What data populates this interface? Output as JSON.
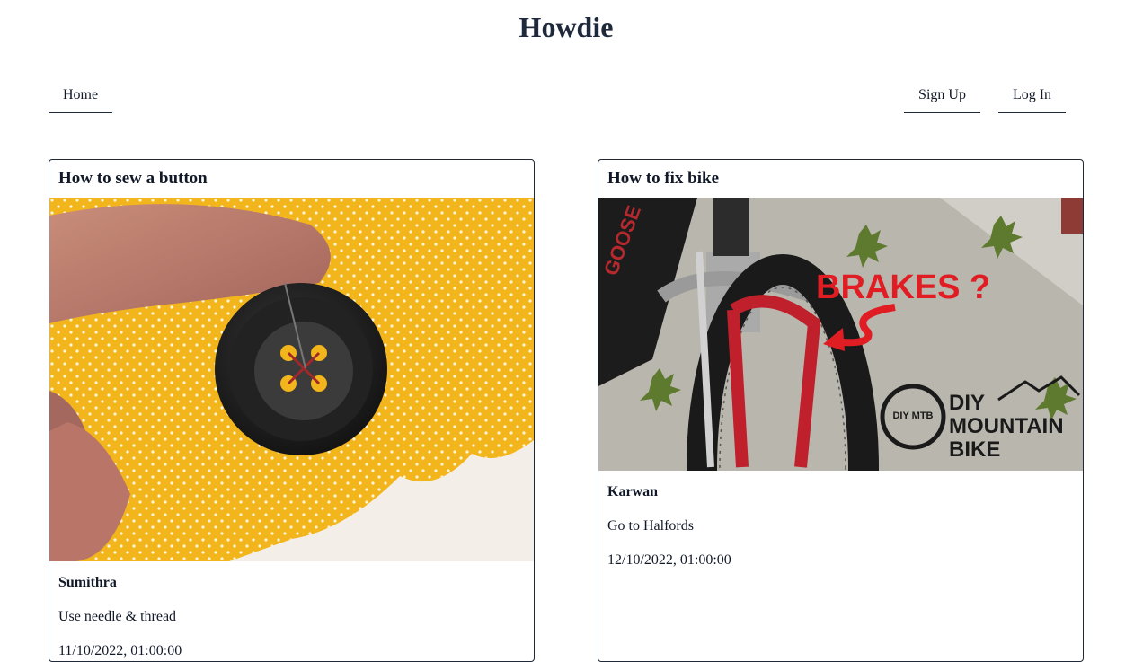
{
  "site": {
    "title": "Howdie"
  },
  "nav": {
    "home": "Home",
    "sign_up": "Sign Up",
    "log_in": "Log In"
  },
  "posts": [
    {
      "title": "How to sew a button",
      "author": "Sumithra",
      "body": "Use needle & thread",
      "date": "11/10/2022, 01:00:00",
      "image": "photo of a hand holding a button being sewn onto yellow polka-dot fabric"
    },
    {
      "title": "How to fix bike",
      "author": "Karwan",
      "body": "Go to Halfords",
      "date": "12/10/2022, 01:00:00",
      "image": "photo of a red mountain bike front brake",
      "image_text": {
        "headline": "BRAKES ?",
        "logo_line1": "DIY",
        "logo_line2": "MOUNTAIN",
        "logo_line3": "BIKE",
        "badge": "DIY MTB",
        "frame_brand": "GOOSE"
      }
    }
  ]
}
